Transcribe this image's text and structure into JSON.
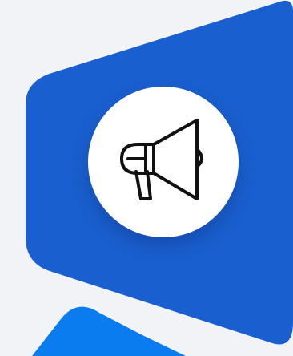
{
  "colors": {
    "background": "#f1f3f6",
    "panel_primary": "#1a5fcf",
    "panel_secondary": "#0a7cf0",
    "icon_circle": "#ffffff",
    "icon_stroke": "#111111"
  },
  "icons": {
    "main": "megaphone-icon"
  }
}
